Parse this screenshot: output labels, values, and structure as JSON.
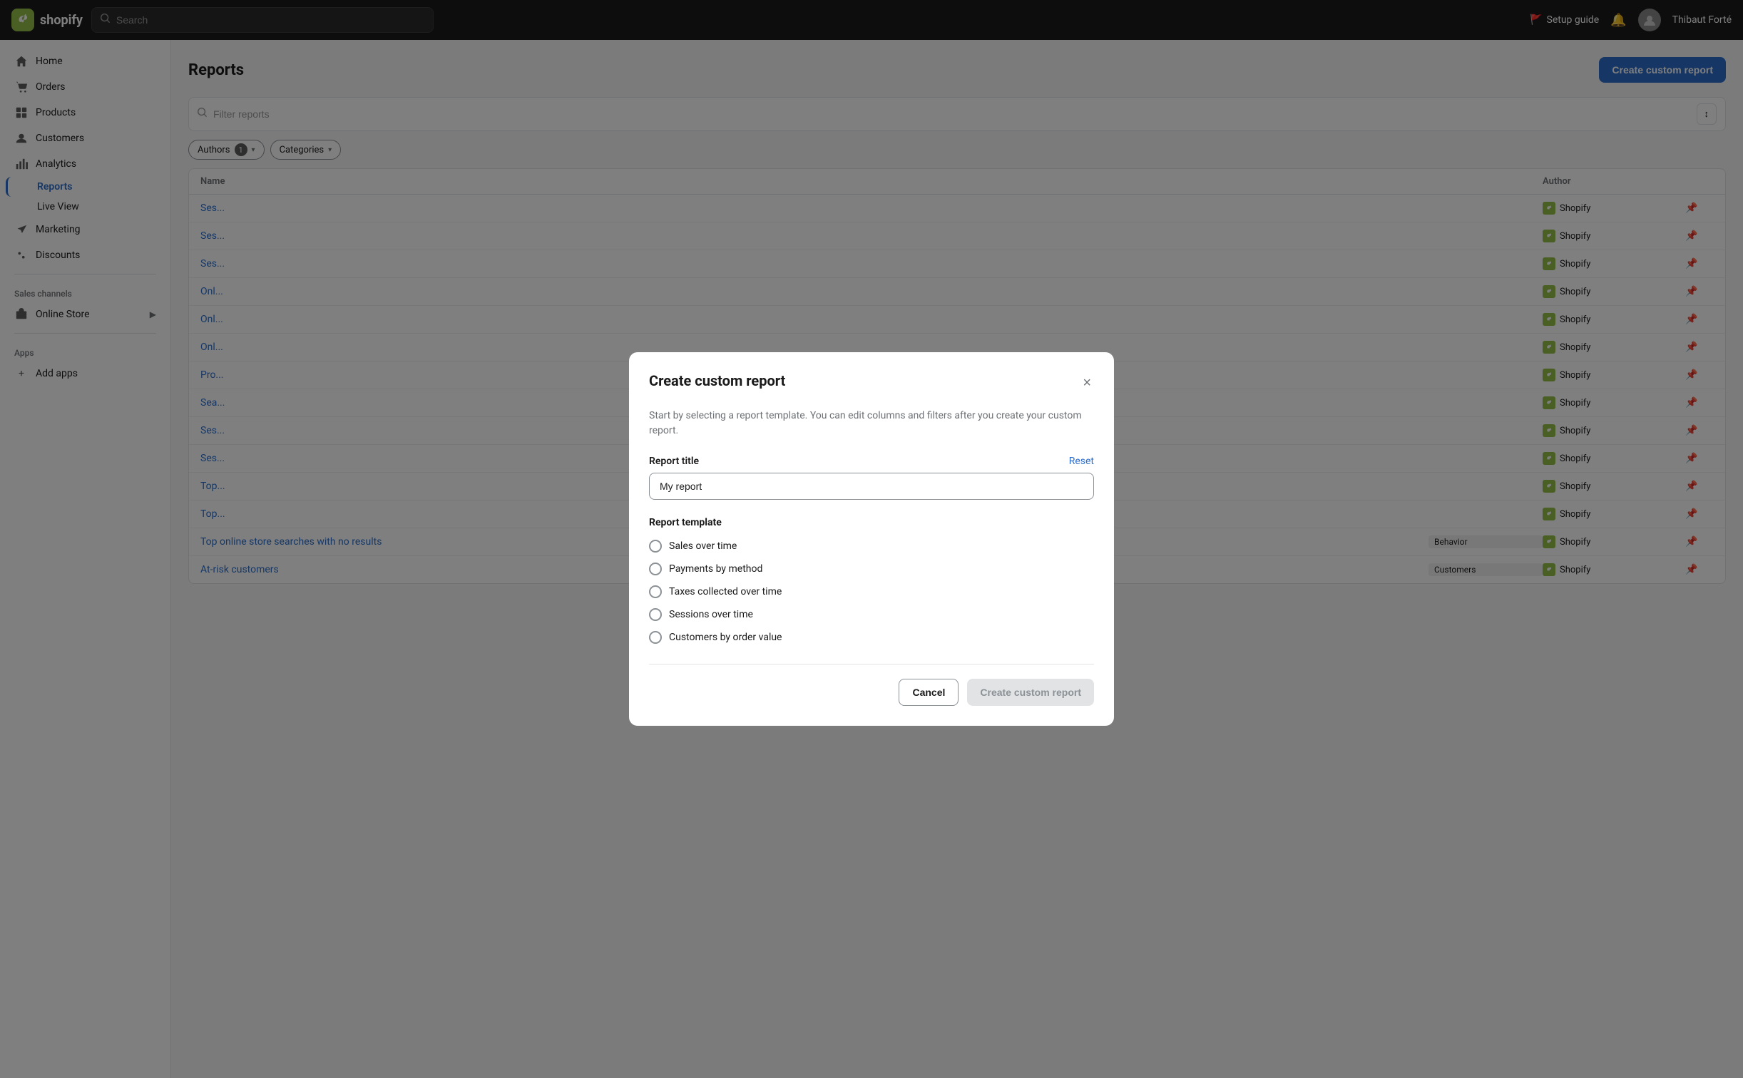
{
  "topbar": {
    "logo_text": "shopify",
    "search_placeholder": "Search",
    "setup_guide_label": "Setup guide",
    "user_name": "Thibaut Forté"
  },
  "sidebar": {
    "items": [
      {
        "id": "home",
        "label": "Home",
        "icon": "home-icon"
      },
      {
        "id": "orders",
        "label": "Orders",
        "icon": "orders-icon"
      },
      {
        "id": "products",
        "label": "Products",
        "icon": "products-icon"
      },
      {
        "id": "customers",
        "label": "Customers",
        "icon": "customers-icon"
      },
      {
        "id": "analytics",
        "label": "Analytics",
        "icon": "analytics-icon"
      },
      {
        "id": "marketing",
        "label": "Marketing",
        "icon": "marketing-icon"
      },
      {
        "id": "discounts",
        "label": "Discounts",
        "icon": "discounts-icon"
      }
    ],
    "sub_items": [
      {
        "id": "reports",
        "label": "Reports",
        "active": true
      },
      {
        "id": "live-view",
        "label": "Live View",
        "active": false
      }
    ],
    "sales_channels_label": "Sales channels",
    "online_store_label": "Online Store",
    "apps_label": "Apps",
    "add_apps_label": "Add apps"
  },
  "page": {
    "title": "Reports",
    "create_btn_label": "Create custom report"
  },
  "filter_bar": {
    "placeholder": "Filter reports",
    "authors_filter": "Authors",
    "authors_count": "1",
    "categories_filter": "Categories"
  },
  "table": {
    "columns": [
      "Name",
      "",
      "Author"
    ],
    "rows": [
      {
        "name": "Ses...",
        "category": "",
        "author": "Shopify"
      },
      {
        "name": "Ses...",
        "category": "",
        "author": "Shopify"
      },
      {
        "name": "Ses...",
        "category": "",
        "author": "Shopify"
      },
      {
        "name": "Onl...",
        "category": "",
        "author": "Shopify"
      },
      {
        "name": "Onl...",
        "category": "",
        "author": "Shopify"
      },
      {
        "name": "Onl...",
        "category": "",
        "author": "Shopify"
      },
      {
        "name": "Pro...",
        "category": "",
        "author": "Shopify"
      },
      {
        "name": "Sea...",
        "category": "",
        "author": "Shopify"
      },
      {
        "name": "Ses...",
        "category": "",
        "author": "Shopify"
      },
      {
        "name": "Ses...",
        "category": "",
        "author": "Shopify"
      },
      {
        "name": "Top...",
        "category": "",
        "author": "Shopify"
      },
      {
        "name": "Top...",
        "category": "",
        "author": "Shopify"
      },
      {
        "name": "Top online store searches with no results",
        "category": "Behavior",
        "author": "Shopify"
      },
      {
        "name": "At-risk customers",
        "category": "Customers",
        "author": "Shopify"
      }
    ]
  },
  "modal": {
    "title": "Create custom report",
    "close_label": "×",
    "description": "Start by selecting a report template. You can edit columns and filters after you create your custom report.",
    "field_label": "Report title",
    "reset_label": "Reset",
    "input_value": "My report",
    "template_label": "Report template",
    "templates": [
      {
        "id": "sales-over-time",
        "label": "Sales over time"
      },
      {
        "id": "payments-by-method",
        "label": "Payments by method"
      },
      {
        "id": "taxes-collected-over-time",
        "label": "Taxes collected over time"
      },
      {
        "id": "sessions-over-time",
        "label": "Sessions over time"
      },
      {
        "id": "customers-by-order-value",
        "label": "Customers by order value"
      }
    ],
    "cancel_label": "Cancel",
    "create_label": "Create custom report"
  }
}
